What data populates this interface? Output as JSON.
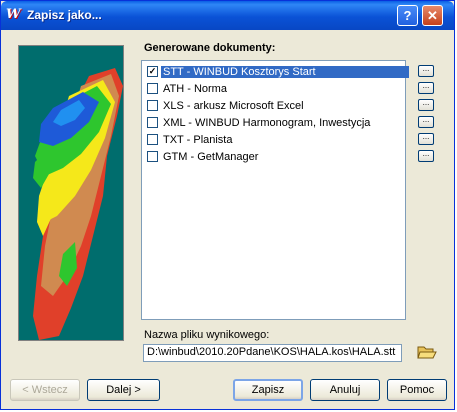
{
  "window": {
    "title": "Zapisz jako...",
    "app_icon_text": "W",
    "help_label": "?",
    "close_label": "✕"
  },
  "documents": {
    "group_label": "Generowane dokumenty:",
    "items": [
      {
        "label": "STT - WINBUD Kosztorys Start",
        "checked": true,
        "selected": true
      },
      {
        "label": "ATH - Norma",
        "checked": false
      },
      {
        "label": "XLS - arkusz Microsoft Excel",
        "checked": false
      },
      {
        "label": "XML - WINBUD Harmonogram, Inwestycja",
        "checked": false
      },
      {
        "label": "TXT - Planista",
        "checked": false
      },
      {
        "label": "GTM - GetManager",
        "checked": false
      }
    ],
    "options_button_label": "...",
    "checkmark": "✓"
  },
  "output": {
    "label": "Nazwa pliku wynikowego:",
    "value": "D:\\winbud\\2010.20Pdane\\KOS\\HALA.kos\\HALA.stt"
  },
  "buttons": {
    "back": "< Wstecz",
    "next": "Dalej >",
    "save": "Zapisz",
    "cancel": "Anuluj",
    "help": "Pomoc"
  }
}
